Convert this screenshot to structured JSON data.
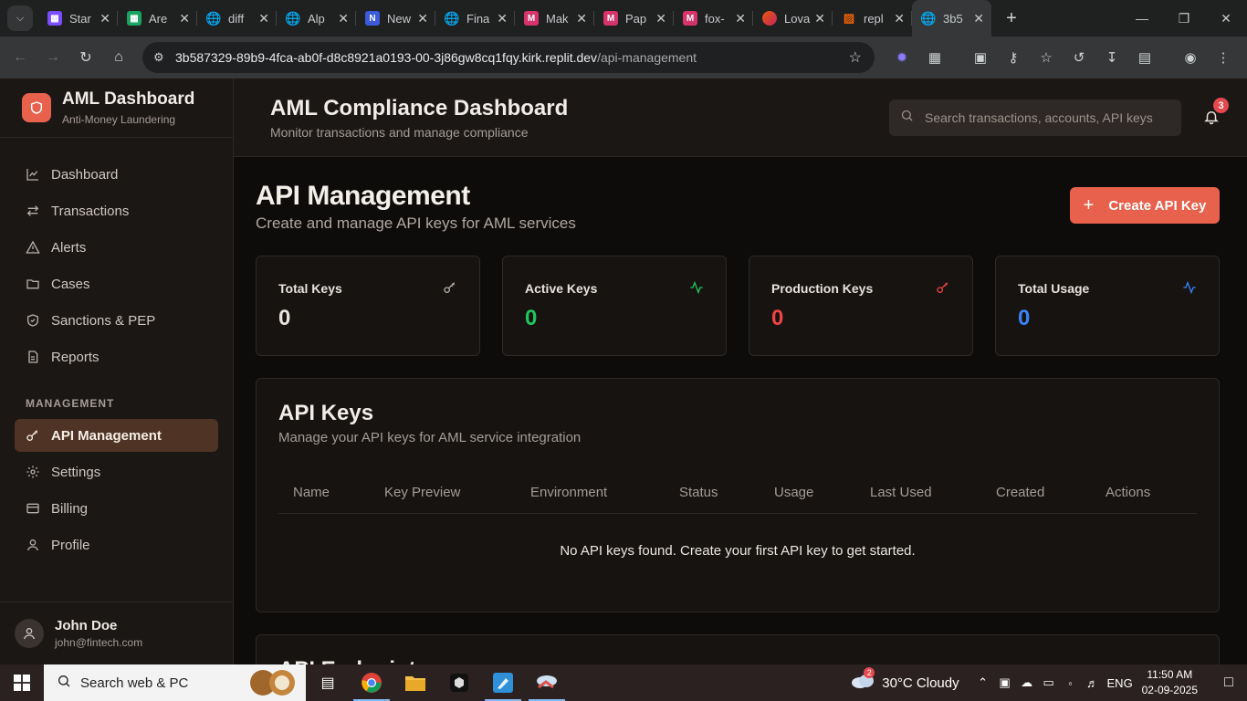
{
  "browser": {
    "tabs": [
      {
        "title": "Star",
        "icon": "purple-square-icon",
        "color": "#7c4dff"
      },
      {
        "title": "Are",
        "icon": "green-sheet-icon",
        "color": "#1aa260"
      },
      {
        "title": "diff",
        "icon": "globe-icon",
        "color": "#9aa0a6"
      },
      {
        "title": "Alp",
        "icon": "globe-icon",
        "color": "#9aa0a6"
      },
      {
        "title": "New",
        "icon": "blue-n-icon",
        "color": "#3b5bdb"
      },
      {
        "title": "Fina",
        "icon": "globe-icon",
        "color": "#9aa0a6"
      },
      {
        "title": "Mak",
        "icon": "red-m-icon",
        "color": "#d6336c"
      },
      {
        "title": "Pap",
        "icon": "red-m-icon",
        "color": "#d6336c"
      },
      {
        "title": "fox-",
        "icon": "red-m-icon",
        "color": "#d6336c"
      },
      {
        "title": "Lova",
        "icon": "heart-icon",
        "color": "#e8590c"
      },
      {
        "title": "repl",
        "icon": "replit-icon",
        "color": "#f26207"
      },
      {
        "title": "3b5",
        "icon": "globe-icon",
        "color": "#9aa0a6",
        "active": true
      }
    ],
    "url_host": "3b587329-89b9-4fca-ab0f-d8c8921a0193-00-3j86gw8cq1fqy.kirk.replit.dev",
    "url_path": "/api-management"
  },
  "sidebar": {
    "brand_title": "AML Dashboard",
    "brand_subtitle": "Anti-Money Laundering",
    "items": [
      {
        "label": "Dashboard"
      },
      {
        "label": "Transactions"
      },
      {
        "label": "Alerts"
      },
      {
        "label": "Cases"
      },
      {
        "label": "Sanctions & PEP"
      },
      {
        "label": "Reports"
      }
    ],
    "section_label": "MANAGEMENT",
    "management_items": [
      {
        "label": "API Management",
        "active": true
      },
      {
        "label": "Settings"
      },
      {
        "label": "Billing"
      },
      {
        "label": "Profile"
      }
    ],
    "user": {
      "name": "John Doe",
      "email": "john@fintech.com"
    }
  },
  "header": {
    "title": "AML Compliance Dashboard",
    "subtitle": "Monitor transactions and manage compliance",
    "search_placeholder": "Search transactions, accounts, API keys",
    "notification_count": "3"
  },
  "page": {
    "title": "API Management",
    "subtitle": "Create and manage API keys for AML services",
    "create_button": "Create API Key"
  },
  "stats": [
    {
      "label": "Total Keys",
      "value": "0",
      "color": "#e8e2dc",
      "icon": "key-icon"
    },
    {
      "label": "Active Keys",
      "value": "0",
      "color": "#22c55e",
      "icon": "activity-icon"
    },
    {
      "label": "Production Keys",
      "value": "0",
      "color": "#ef4444",
      "icon": "key-icon"
    },
    {
      "label": "Total Usage",
      "value": "0",
      "color": "#3b82f6",
      "icon": "activity-icon"
    }
  ],
  "keys_card": {
    "title": "API Keys",
    "subtitle": "Manage your API keys for AML service integration",
    "columns": [
      "Name",
      "Key Preview",
      "Environment",
      "Status",
      "Usage",
      "Last Used",
      "Created",
      "Actions"
    ],
    "empty_message": "No API keys found. Create your first API key to get started."
  },
  "endpoints_card": {
    "title": "API Endpoints"
  },
  "taskbar": {
    "search_text": "Search web & PC",
    "weather": "30°C  Cloudy",
    "weather_badge": "2",
    "language": "ENG",
    "time": "11:50 AM",
    "date": "02-09-2025"
  },
  "colors": {
    "accent": "#e8614d",
    "active_nav": "#4f3325"
  }
}
